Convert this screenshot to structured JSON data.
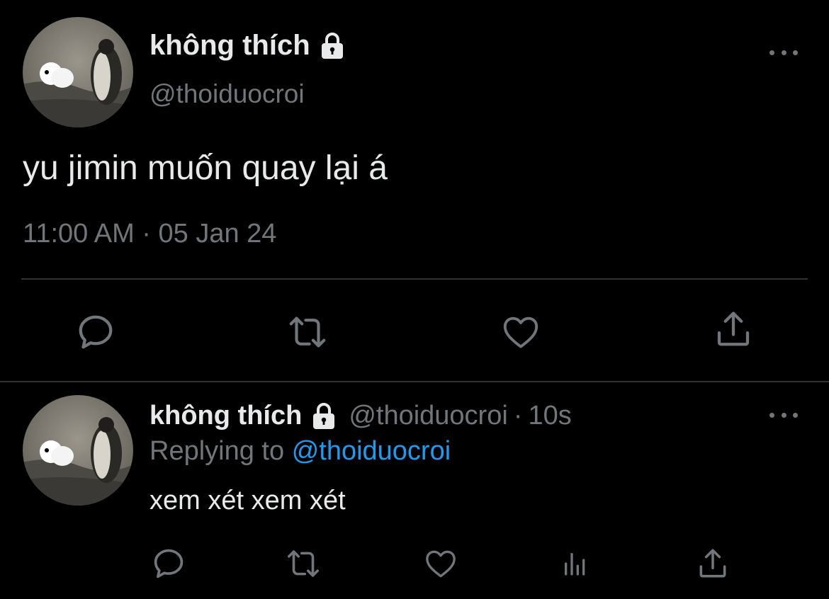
{
  "main_tweet": {
    "display_name": "không thích",
    "handle": "@thoiduocroi",
    "text": "yu jimin muốn quay lại á",
    "meta": "11:00 AM · 05 Jan 24",
    "icons": {
      "lock": "lock-icon",
      "more": "more-icon",
      "reply": "reply-icon",
      "retweet": "retweet-icon",
      "like": "heart-icon",
      "share": "share-icon"
    }
  },
  "reply_tweet": {
    "display_name": "không thích",
    "handle": "@thoiduocroi",
    "separator": "·",
    "time": "10s",
    "replying_prefix": "Replying to",
    "replying_handle": "@thoiduocroi",
    "text": "xem xét xem xét",
    "icons": {
      "lock": "lock-icon",
      "more": "more-icon",
      "reply": "reply-icon",
      "retweet": "retweet-icon",
      "like": "heart-icon",
      "analytics": "analytics-icon",
      "share": "share-icon"
    }
  },
  "colors": {
    "background": "#000000",
    "primary_text": "#e7e9ea",
    "secondary_text": "#71767b",
    "link": "#1d9bf0",
    "divider": "#2f3336"
  }
}
